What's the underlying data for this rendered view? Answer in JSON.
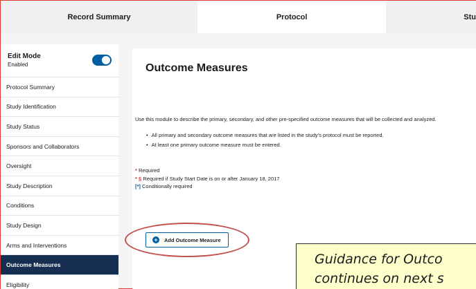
{
  "tabs": [
    {
      "label": "Record Summary"
    },
    {
      "label": "Protocol"
    },
    {
      "label": "Stu"
    }
  ],
  "sidebar": {
    "edit_mode": {
      "title": "Edit Mode",
      "status": "Enabled",
      "toggle_on": true
    },
    "items": [
      {
        "label": "Protocol Summary"
      },
      {
        "label": "Study Identification"
      },
      {
        "label": "Study Status"
      },
      {
        "label": "Sponsors and Collaborators"
      },
      {
        "label": "Oversight"
      },
      {
        "label": "Study Description"
      },
      {
        "label": "Conditions"
      },
      {
        "label": "Study Design"
      },
      {
        "label": "Arms and Interventions"
      },
      {
        "label": "Outcome Measures",
        "active": true
      },
      {
        "label": "Eligibility"
      }
    ]
  },
  "main": {
    "title": "Outcome Measures",
    "intro": "Use this module to describe the primary, secondary, and other pre-specified outcome measures that will be collected and analyzed.",
    "bullets": [
      "All primary and secondary outcome measures that are listed in the study's protocol must be reported.",
      "At least one primary outcome measure must be entered."
    ],
    "legend": {
      "required_mark": "*",
      "required_text": "Required",
      "start_date_mark": "* §",
      "start_date_text": "Required if Study Start Date is on or after January 18, 2017",
      "conditional_mark": "[*]",
      "conditional_text": "Conditionally required"
    },
    "add_button": {
      "label": "Add Outcome Measure",
      "icon": "plus-circle-icon"
    }
  },
  "guidance": {
    "line1": "Guidance for Outco",
    "line2": "continues on next s"
  },
  "colors": {
    "primary": "#005ea2",
    "active_nav": "#162e51",
    "required": "#d83933",
    "highlight_circle": "#c0504d",
    "guidance_bg": "#ffffcc"
  }
}
